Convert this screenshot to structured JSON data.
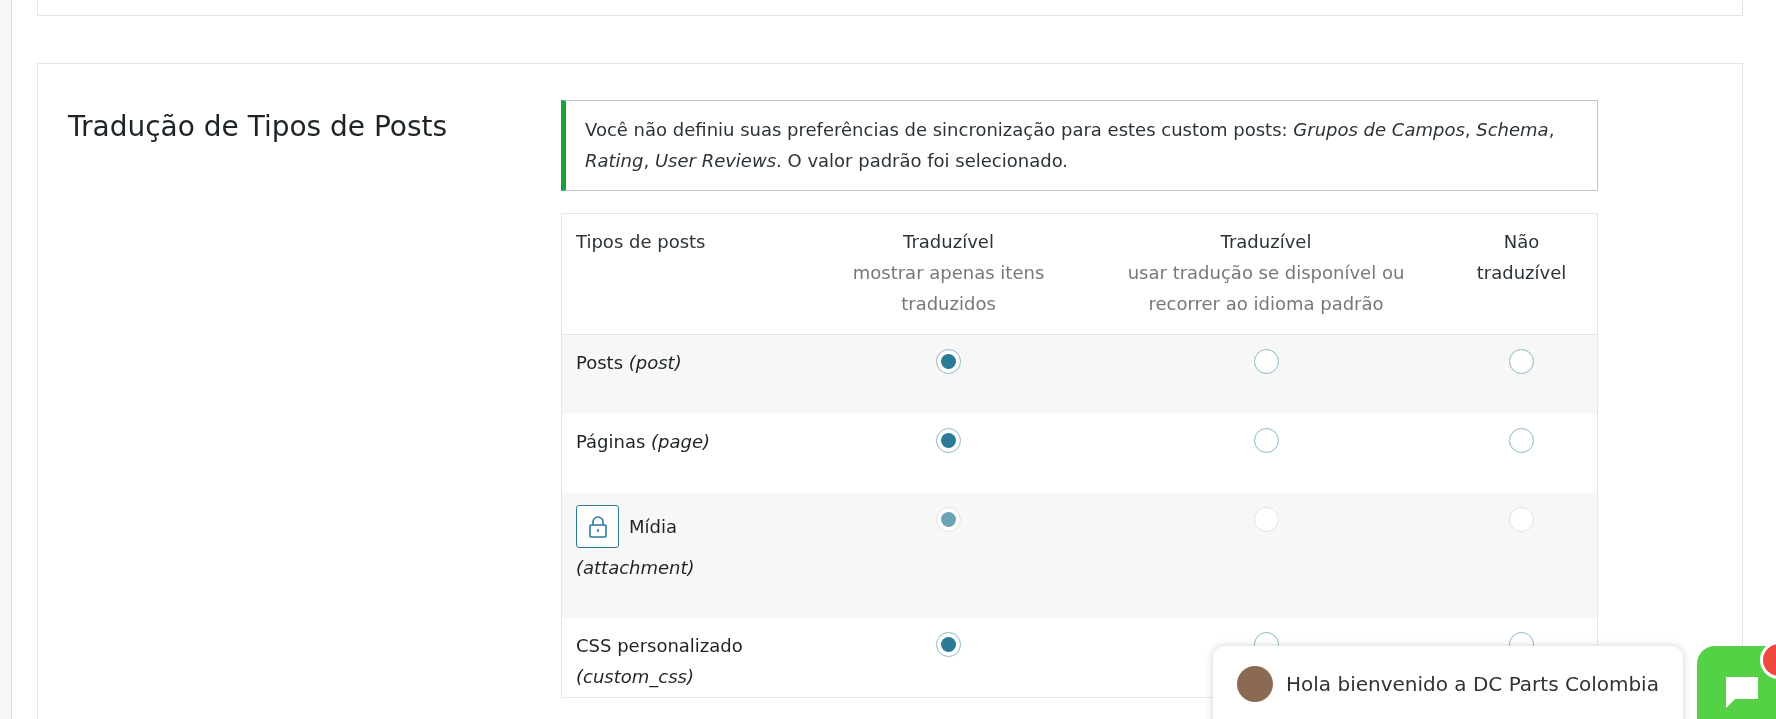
{
  "section": {
    "title": "Tradução de Tipos de Posts"
  },
  "notice": {
    "text": "Você não definiu suas preferências de sincronização para estes custom posts: *Grupos de Campos*, *Schema*, *Rating*, *User Reviews*. O valor padrão foi selecionado."
  },
  "table": {
    "columns": [
      {
        "title": "Tipos de posts"
      },
      {
        "title": "Traduzível",
        "subtitle": "mostrar apenas itens traduzidos"
      },
      {
        "title": "Traduzível",
        "subtitle": "usar tradução se disponível ou recorrer ao idioma padrão"
      },
      {
        "title": "Não traduzível"
      }
    ],
    "rows": [
      {
        "name": "Posts",
        "slug": "(post)",
        "locked": false,
        "disabled": false,
        "options": [
          {
            "selected": true
          },
          {
            "selected": false
          },
          {
            "selected": false
          }
        ]
      },
      {
        "name": "Páginas",
        "slug": "(page)",
        "locked": false,
        "disabled": false,
        "options": [
          {
            "selected": true
          },
          {
            "selected": false
          },
          {
            "selected": false
          }
        ]
      },
      {
        "name": "Mídia",
        "slug": "(attachment)",
        "locked": true,
        "disabled": true,
        "options": [
          {
            "selected": true
          },
          {
            "selected": false
          },
          {
            "selected": false
          }
        ]
      },
      {
        "name": "CSS personalizado",
        "slug": "(custom_css)",
        "locked": false,
        "disabled": false,
        "options": [
          {
            "selected": true
          },
          {
            "selected": false
          },
          {
            "selected": false
          }
        ]
      }
    ]
  },
  "chat": {
    "message": "Hola bienvenido a DC Parts Colombia",
    "unread": true
  }
}
